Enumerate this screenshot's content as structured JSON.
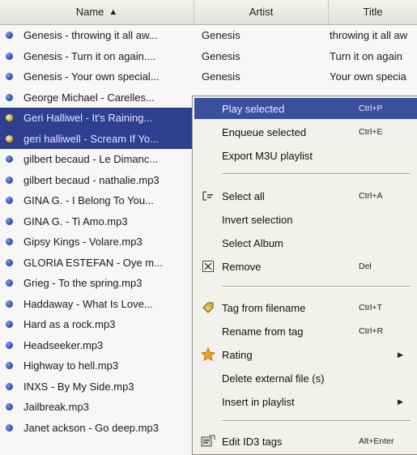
{
  "columns": {
    "name": "Name",
    "artist": "Artist",
    "title": "Title"
  },
  "rows": [
    {
      "name": "Genesis - throwing it all aw...",
      "artist": "Genesis",
      "title": "throwing it all aw",
      "selected": false
    },
    {
      "name": "Genesis - Turn it on again....",
      "artist": "Genesis",
      "title": "Turn it on again",
      "selected": false
    },
    {
      "name": "Genesis - Your own special...",
      "artist": "Genesis",
      "title": "Your own specia",
      "selected": false
    },
    {
      "name": "George Michael - Carelles...",
      "artist": "",
      "title": "",
      "selected": false
    },
    {
      "name": "Geri Halliwel - It's Raining...",
      "artist": "",
      "title": "",
      "selected": true
    },
    {
      "name": "geri halliwell - Scream If Yo...",
      "artist": "",
      "title": "",
      "selected": true
    },
    {
      "name": "gilbert becaud - Le Dimanc...",
      "artist": "",
      "title": "",
      "selected": false
    },
    {
      "name": "gilbert becaud - nathalie.mp3",
      "artist": "",
      "title": "",
      "selected": false
    },
    {
      "name": "GINA G. - I Belong To You...",
      "artist": "",
      "title": "",
      "selected": false
    },
    {
      "name": "GINA G. - Ti Amo.mp3",
      "artist": "",
      "title": "",
      "selected": false
    },
    {
      "name": "Gipsy Kings - Volare.mp3",
      "artist": "",
      "title": "",
      "selected": false
    },
    {
      "name": "GLORIA ESTEFAN - Oye m...",
      "artist": "",
      "title": "",
      "selected": false
    },
    {
      "name": "Grieg - To the spring.mp3",
      "artist": "",
      "title": "",
      "selected": false
    },
    {
      "name": "Haddaway - What Is Love...",
      "artist": "",
      "title": "",
      "selected": false
    },
    {
      "name": "Hard as a rock.mp3",
      "artist": "",
      "title": "",
      "selected": false
    },
    {
      "name": "Headseeker.mp3",
      "artist": "",
      "title": "",
      "selected": false
    },
    {
      "name": "Highway to hell.mp3",
      "artist": "",
      "title": "",
      "selected": false
    },
    {
      "name": "INXS - By My Side.mp3",
      "artist": "",
      "title": "",
      "selected": false
    },
    {
      "name": "Jailbreak.mp3",
      "artist": "",
      "title": "",
      "selected": false
    },
    {
      "name": "Janet ackson - Go deep.mp3",
      "artist": "",
      "title": "",
      "selected": false
    }
  ],
  "menu": {
    "play_selected": {
      "label": "Play selected",
      "shortcut": "Ctrl+P"
    },
    "enqueue_selected": {
      "label": "Enqueue selected",
      "shortcut": "Ctrl+E"
    },
    "export_m3u": {
      "label": "Export M3U playlist"
    },
    "select_all": {
      "label": "Select all",
      "shortcut": "Ctrl+A"
    },
    "invert_selection": {
      "label": "Invert selection"
    },
    "select_album": {
      "label": "Select Album"
    },
    "remove": {
      "label": "Remove",
      "shortcut": "Del"
    },
    "tag_from_filename": {
      "label": "Tag from filename",
      "shortcut": "Ctrl+T"
    },
    "rename_from_tag": {
      "label": "Rename from tag",
      "shortcut": "Ctrl+R"
    },
    "rating": {
      "label": "Rating"
    },
    "delete_external": {
      "label": "Delete external file (s)"
    },
    "insert_in_playlist": {
      "label": "Insert in playlist"
    },
    "edit_id3": {
      "label": "Edit ID3 tags",
      "shortcut": "Alt+Enter"
    }
  },
  "icons": {
    "sort": "sort-ascending-icon",
    "bullet": "audio-file-bullet-icon",
    "select_all": "select-all-icon",
    "remove": "remove-x-icon",
    "tag": "tag-icon",
    "rating": "star-icon",
    "edit_id3": "edit-tags-icon",
    "submenu": "submenu-arrow-icon"
  },
  "colors": {
    "selection": "#2f3f8f",
    "menu_highlight": "#3a4f9d",
    "star": "#f0a020"
  }
}
